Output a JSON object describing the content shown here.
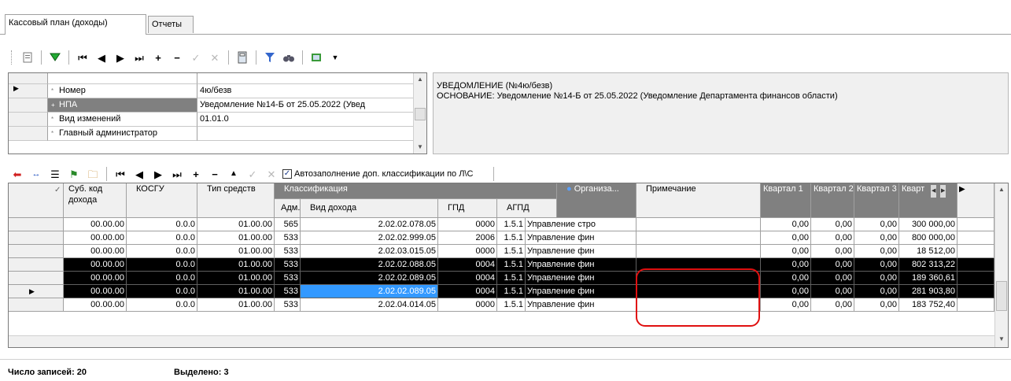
{
  "tabs": [
    {
      "label": "Кассовый план (доходы)",
      "active": true
    },
    {
      "label": "Отчеты",
      "active": false
    }
  ],
  "form": {
    "rows": [
      {
        "label": "Номер",
        "value": "4ю/безв",
        "current": true,
        "selected": false
      },
      {
        "label": "НПА",
        "value": "Уведомление  №14-Б от 25.05.2022 (Увед",
        "current": false,
        "selected": true
      },
      {
        "label": "Вид изменений",
        "value": "01.01.0",
        "current": false,
        "selected": false
      },
      {
        "label": "Главный администратор",
        "value": "",
        "current": false,
        "selected": false
      }
    ]
  },
  "notice": {
    "line1": "УВЕДОМЛЕНИЕ  (№4ю/безв)",
    "line2": "ОСНОВАНИЕ: Уведомление  №14-Б от 25.05.2022 (Уведомление Департамента финансов области)"
  },
  "grid_toolbar": {
    "autofill_label": "Автозаполнение доп. классификации по Л\\С",
    "autofill_checked": true
  },
  "grid": {
    "headers": {
      "sub_code": "Суб. код дохода",
      "kosgu": "КОСГУ",
      "fund_type": "Тип средств",
      "classification": "Классификация",
      "adm": "Адм...",
      "income_type": "Вид дохода",
      "gpd": "ГПД",
      "agpd": "АГПД",
      "org": "Организа...",
      "note": "Примечание",
      "q1": "Квартал 1",
      "q2": "Квартал 2",
      "q3": "Квартал 3",
      "q4": "Кварт"
    },
    "rows": [
      {
        "sub": "00.00.00",
        "kosgu": "0.0.0",
        "type": "01.00.00",
        "adm": "565",
        "income": "2.02.02.078.05",
        "gpd": "0000",
        "agpd": "1.5.1",
        "org": "Управление стро",
        "note": "",
        "q1": "0,00",
        "q2": "0,00",
        "q3": "0,00",
        "q4": "300 000,00",
        "selected": false,
        "current": false
      },
      {
        "sub": "00.00.00",
        "kosgu": "0.0.0",
        "type": "01.00.00",
        "adm": "533",
        "income": "2.02.02.999.05",
        "gpd": "2006",
        "agpd": "1.5.1",
        "org": "Управление фин",
        "note": "",
        "q1": "0,00",
        "q2": "0,00",
        "q3": "0,00",
        "q4": "800 000,00",
        "selected": false,
        "current": false
      },
      {
        "sub": "00.00.00",
        "kosgu": "0.0.0",
        "type": "01.00.00",
        "adm": "533",
        "income": "2.02.03.015.05",
        "gpd": "0000",
        "agpd": "1.5.1",
        "org": "Управление фин",
        "note": "",
        "q1": "0,00",
        "q2": "0,00",
        "q3": "0,00",
        "q4": "18 512,00",
        "selected": false,
        "current": false
      },
      {
        "sub": "00.00.00",
        "kosgu": "0.0.0",
        "type": "01.00.00",
        "adm": "533",
        "income": "2.02.02.088.05",
        "gpd": "0004",
        "agpd": "1.5.1",
        "org": "Управление фин",
        "note": "",
        "q1": "0,00",
        "q2": "0,00",
        "q3": "0,00",
        "q4": "802 313,22",
        "selected": true,
        "current": false
      },
      {
        "sub": "00.00.00",
        "kosgu": "0.0.0",
        "type": "01.00.00",
        "adm": "533",
        "income": "2.02.02.089.05",
        "gpd": "0004",
        "agpd": "1.5.1",
        "org": "Управление фин",
        "note": "",
        "q1": "0,00",
        "q2": "0,00",
        "q3": "0,00",
        "q4": "189 360,61",
        "selected": true,
        "current": false
      },
      {
        "sub": "00.00.00",
        "kosgu": "0.0.0",
        "type": "01.00.00",
        "adm": "533",
        "income": "2.02.02.089.05",
        "gpd": "0004",
        "agpd": "1.5.1",
        "org": "Управление фин",
        "note": "",
        "q1": "0,00",
        "q2": "0,00",
        "q3": "0,00",
        "q4": "281 903,80",
        "selected": true,
        "current": true
      },
      {
        "sub": "00.00.00",
        "kosgu": "0.0.0",
        "type": "01.00.00",
        "adm": "533",
        "income": "2.02.04.014.05",
        "gpd": "0000",
        "agpd": "1.5.1",
        "org": "Управление фин",
        "note": "",
        "q1": "0,00",
        "q2": "0,00",
        "q3": "0,00",
        "q4": "183 752,40",
        "selected": false,
        "current": false
      }
    ]
  },
  "status": {
    "records_label": "Число записей:",
    "records_value": "20",
    "selected_label": "Выделено:",
    "selected_value": "3"
  },
  "colors": {
    "selection_row": "#000000",
    "current_cell": "#3399ff",
    "highlight_outline": "#e01010"
  }
}
